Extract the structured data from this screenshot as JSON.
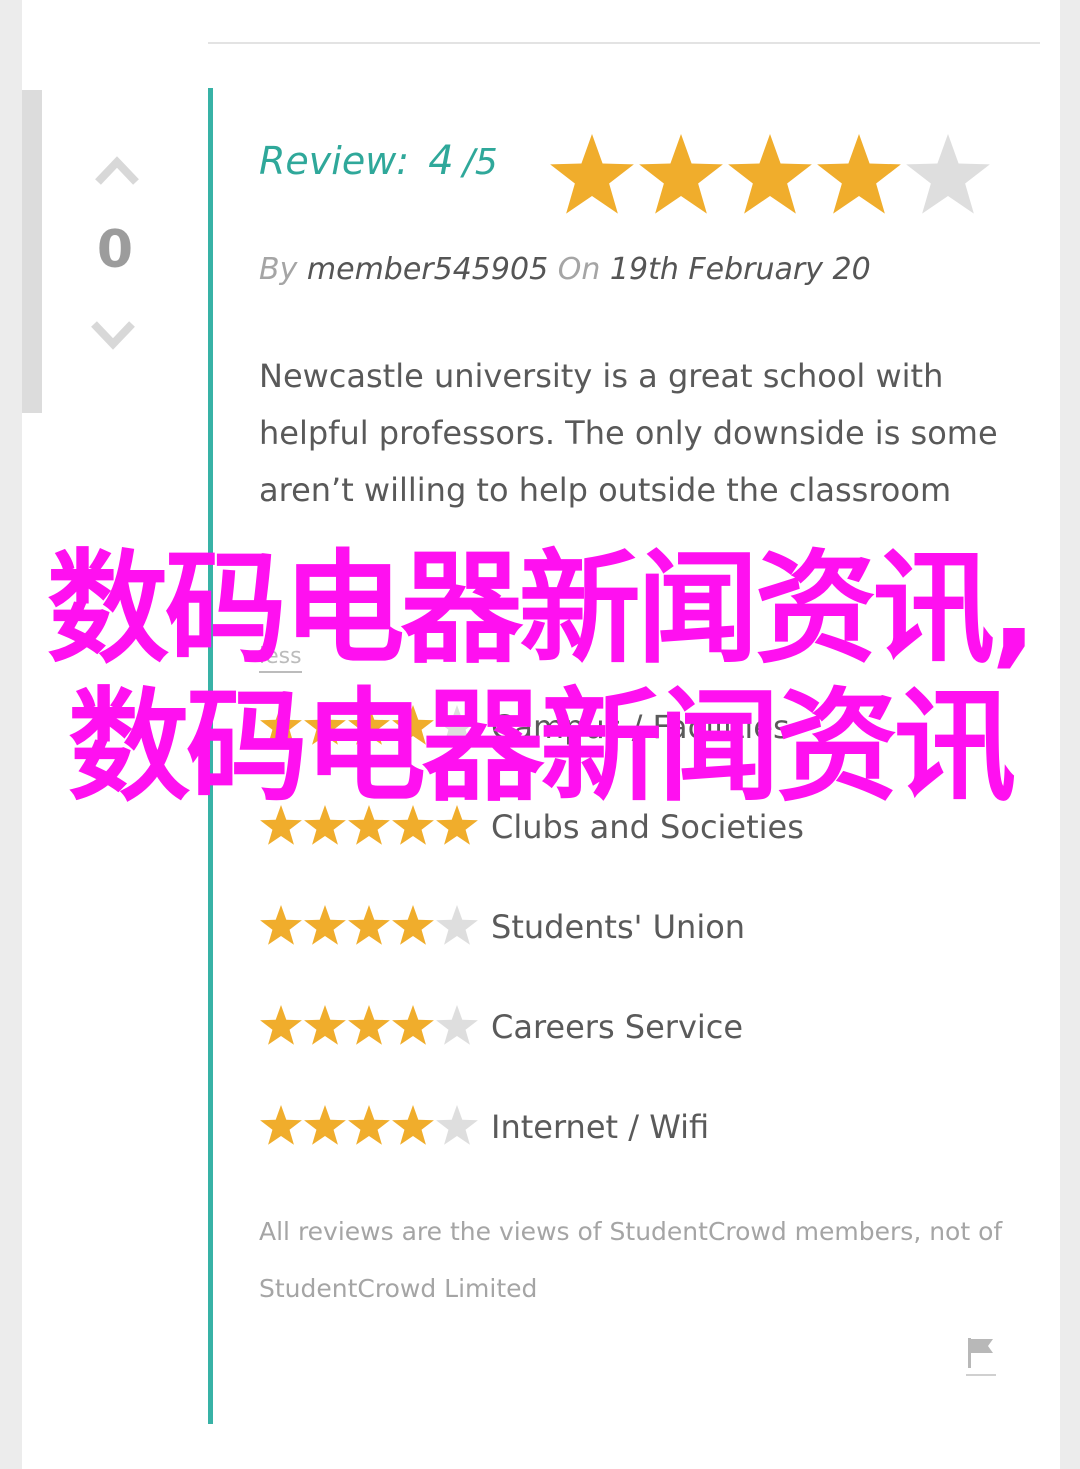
{
  "vote": {
    "count": "0",
    "up_icon": "chevron-up-icon",
    "down_icon": "chevron-down-icon"
  },
  "review": {
    "label": "Review:",
    "score": "4",
    "out_of": "/5",
    "rating_value": 4,
    "rating_max": 5,
    "by_prefix": "By",
    "author": "member545905",
    "on_prefix": "On",
    "date": "19th February 20",
    "text": "Newcastle university is a great school with helpful professors. The only downside is some aren’t willing to help outside the classroom",
    "more_label": "less"
  },
  "categories": [
    {
      "name": "Campus / Facilities",
      "rating": 4
    },
    {
      "name": "Clubs and Societies",
      "rating": 5
    },
    {
      "name": "Students' Union",
      "rating": 4
    },
    {
      "name": "Careers Service",
      "rating": 4
    },
    {
      "name": "Internet / Wifi",
      "rating": 4
    }
  ],
  "disclaimer": "All reviews are the views of StudentCrowd members, not of StudentCrowd Limited",
  "flag_icon": "flag-icon",
  "overlay_text": "数码电器新闻资讯,数码电器新闻资讯",
  "colors": {
    "accent_teal": "#38b2a6",
    "star_filled": "#f0ad2c",
    "star_empty": "#dedede",
    "overlay": "#ff10f0"
  }
}
